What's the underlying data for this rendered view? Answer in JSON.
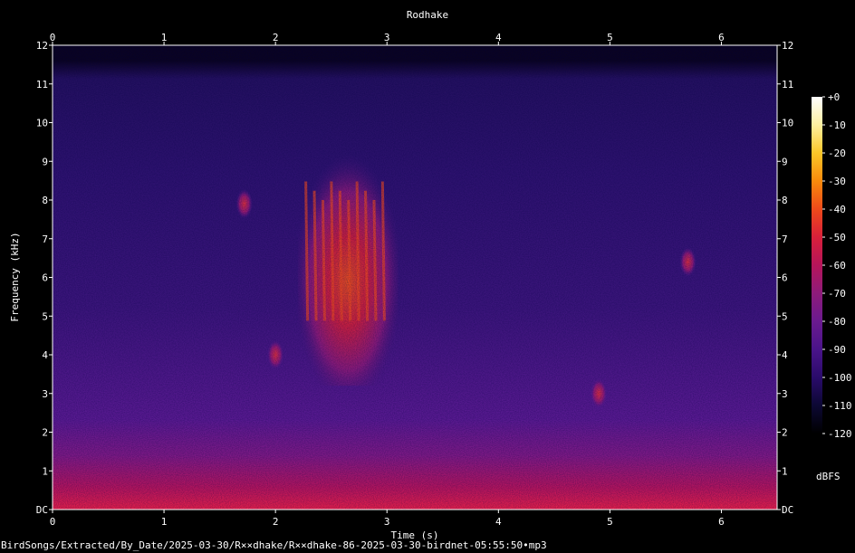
{
  "chart_data": {
    "type": "heatmap",
    "title": "Rodhake",
    "xlabel": "Time (s)",
    "ylabel": "Frequency (kHz)",
    "xlim": [
      0,
      6.5
    ],
    "ylim": [
      0,
      12
    ],
    "x_ticks": [
      "0",
      "1",
      "2",
      "3",
      "4",
      "5",
      "6"
    ],
    "y_ticks": [
      "DC",
      "1",
      "2",
      "3",
      "4",
      "5",
      "6",
      "7",
      "8",
      "9",
      "10",
      "11",
      "12"
    ],
    "colorbar": {
      "label": "dBFS",
      "range": [
        -120,
        0
      ],
      "ticks": [
        "+0",
        "-10",
        "-20",
        "-30",
        "-40",
        "-50",
        "-60",
        "-70",
        "-80",
        "-90",
        "-100",
        "-110",
        "-120"
      ],
      "colormap": [
        "#000000",
        "#0c0833",
        "#2a0b6b",
        "#4a148a",
        "#6a1a8f",
        "#8e1b7a",
        "#b6155a",
        "#d8203a",
        "#ee4a1a",
        "#f98a0c",
        "#fbc628",
        "#fdf0a0",
        "#ffffff"
      ]
    },
    "content_max_khz": 11.6,
    "annotations": [
      {
        "name": "song-burst",
        "t_start": 2.2,
        "t_end": 3.1,
        "f_low": 3.2,
        "f_high": 9.2,
        "level_db": -35
      },
      {
        "name": "note-a",
        "t": 1.72,
        "f": 7.9,
        "level_db": -55
      },
      {
        "name": "note-b",
        "t": 2.0,
        "f": 4.0,
        "level_db": -35
      },
      {
        "name": "note-c",
        "t": 5.7,
        "f": 6.4,
        "level_db": -60
      },
      {
        "name": "chirp-d",
        "t": 4.9,
        "f": 3.0,
        "level_db": -65
      }
    ]
  },
  "footer": {
    "file_path": "BirdSongs/Extracted/By_Date/2025-03-30/R××dhake/R××dhake-86-2025-03-30-birdnet-05:55:50•mp3"
  }
}
